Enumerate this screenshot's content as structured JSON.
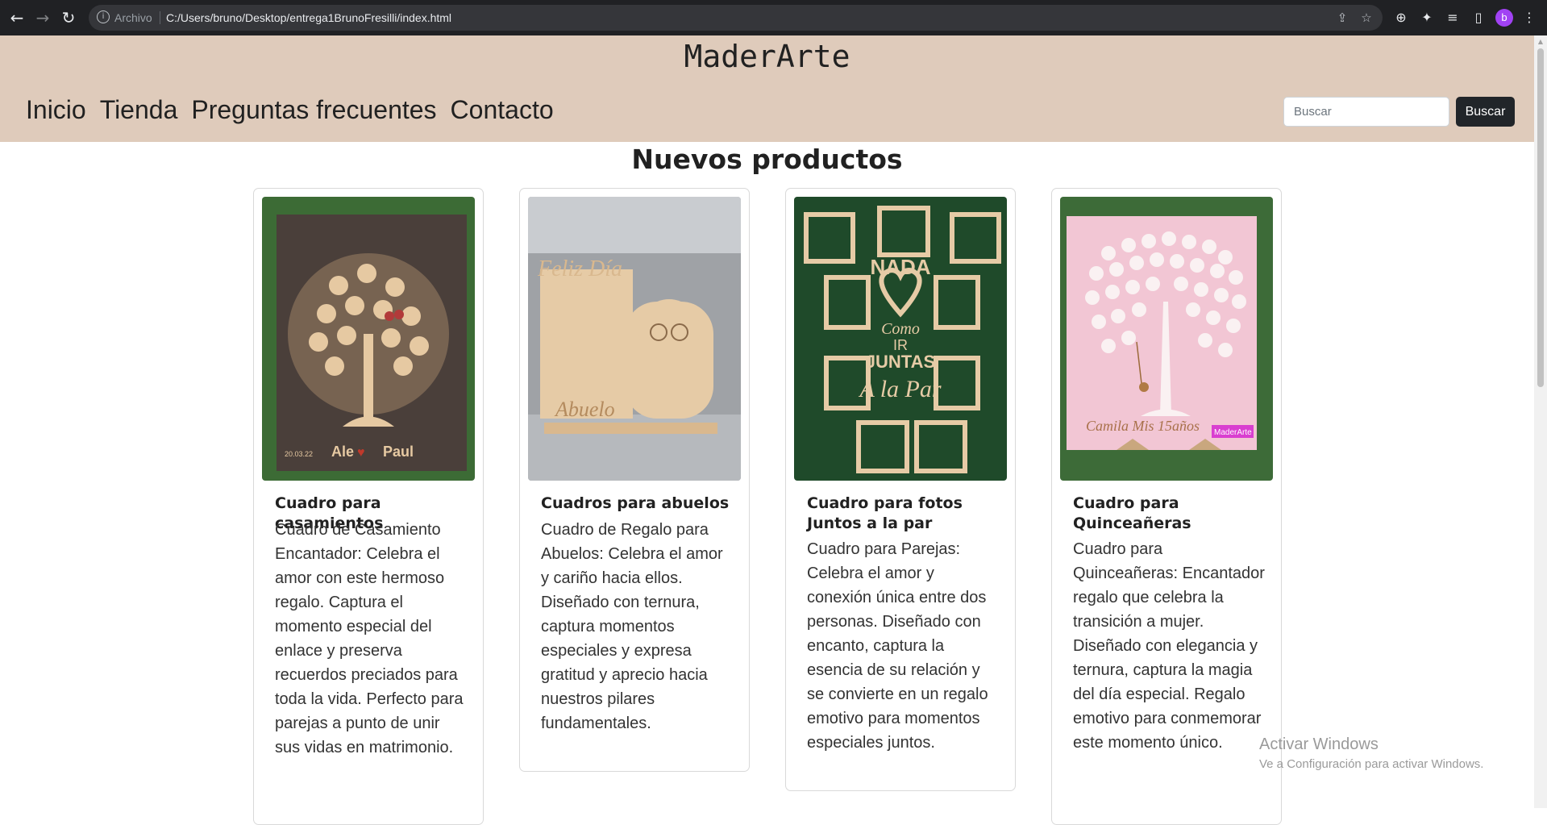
{
  "browser": {
    "omnibox_label": "Archivo",
    "url": "C:/Users/bruno/Desktop/entrega1BrunoFresilli/index.html",
    "profile_initial": "b"
  },
  "header": {
    "brand": "MaderArte",
    "nav": [
      "Inicio",
      "Tienda",
      "Preguntas frecuentes",
      "Contacto"
    ],
    "search_placeholder": "Buscar",
    "search_button": "Buscar"
  },
  "main": {
    "title": "Nuevos productos",
    "products": [
      {
        "title": "Cuadro para casamientos",
        "description": "Cuadro de Casamiento Encantador: Celebra el amor con este hermoso regalo. Captura el momento especial del enlace y preserva recuerdos preciados para toda la vida. Perfecto para parejas a punto de unir sus vidas en matrimonio.",
        "image_text": [
          "20.03.22",
          "Ale",
          "Paul"
        ]
      },
      {
        "title": "Cuadros para abuelos",
        "description": "Cuadro de Regalo para Abuelos: Celebra el amor y cariño hacia ellos. Diseñado con ternura, captura momentos especiales y expresa gratitud y aprecio hacia nuestros pilares fundamentales.",
        "image_text": [
          "Feliz Día",
          "Abuelo"
        ]
      },
      {
        "title": "Cuadro para fotos Juntos a la par",
        "description": "Cuadro para Parejas: Celebra el amor y conexión única entre dos personas. Diseñado con encanto, captura la esencia de su relación y se convierte en un regalo emotivo para momentos especiales juntos.",
        "image_text": [
          "NADA",
          "Como",
          "IR",
          "JUNTAS",
          "A la Par"
        ]
      },
      {
        "title": "Cuadro para Quinceañeras",
        "description": "Cuadro para Quinceañeras: Encantador regalo que celebra la transición a mujer. Diseñado con elegancia y ternura, captura la magia del día especial. Regalo emotivo para conmemorar este momento único.",
        "image_text": [
          "Camila Mis 15años",
          "MaderArte"
        ]
      }
    ]
  },
  "watermark": {
    "title": "Activar Windows",
    "subtitle": "Ve a Configuración para activar Windows."
  }
}
